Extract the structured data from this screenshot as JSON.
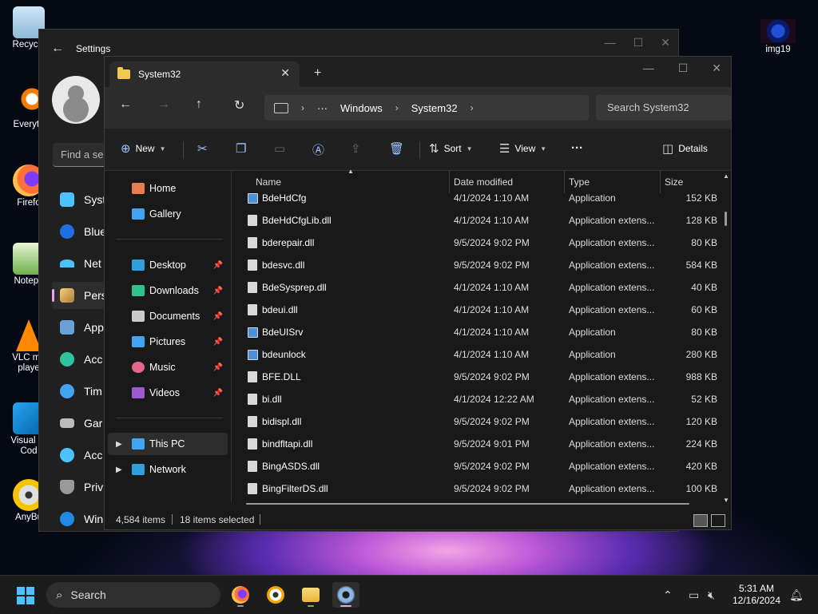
{
  "desktop": {
    "icons": [
      {
        "label": "Recycle"
      },
      {
        "label": "Everyth"
      },
      {
        "label": "Firefo"
      },
      {
        "label": "Notepa"
      },
      {
        "label": "VLC me\nplaye"
      },
      {
        "label": "Visual St\nCod"
      },
      {
        "label": "AnyBu"
      },
      {
        "label": "img19"
      }
    ]
  },
  "settings": {
    "title": "Settings",
    "find_placeholder": "Find a se",
    "nav": [
      "Syst",
      "Blue",
      "Net",
      "Pers",
      "App",
      "Acc",
      "Tim",
      "Gar",
      "Acc",
      "Priv",
      "Win"
    ]
  },
  "explorer": {
    "tab_title": "System32",
    "breadcrumb": [
      "Windows",
      "System32"
    ],
    "search_placeholder": "Search System32",
    "commands": {
      "new": "New",
      "sort": "Sort",
      "view": "View",
      "details": "Details"
    },
    "tree": {
      "home": "Home",
      "gallery": "Gallery",
      "quick": [
        "Desktop",
        "Downloads",
        "Documents",
        "Pictures",
        "Music",
        "Videos"
      ],
      "this_pc": "This PC",
      "network": "Network"
    },
    "columns": {
      "name": "Name",
      "date": "Date modified",
      "type": "Type",
      "size": "Size"
    },
    "files": [
      {
        "name": "BdeHdCfg",
        "date": "4/1/2024 1:10 AM",
        "type": "Application",
        "size": "152 KB",
        "kind": "app"
      },
      {
        "name": "BdeHdCfgLib.dll",
        "date": "4/1/2024 1:10 AM",
        "type": "Application extens...",
        "size": "128 KB",
        "kind": "dll"
      },
      {
        "name": "bderepair.dll",
        "date": "9/5/2024 9:02 PM",
        "type": "Application extens...",
        "size": "80 KB",
        "kind": "dll"
      },
      {
        "name": "bdesvc.dll",
        "date": "9/5/2024 9:02 PM",
        "type": "Application extens...",
        "size": "584 KB",
        "kind": "dll"
      },
      {
        "name": "BdeSysprep.dll",
        "date": "4/1/2024 1:10 AM",
        "type": "Application extens...",
        "size": "40 KB",
        "kind": "dll"
      },
      {
        "name": "bdeui.dll",
        "date": "4/1/2024 1:10 AM",
        "type": "Application extens...",
        "size": "60 KB",
        "kind": "dll"
      },
      {
        "name": "BdeUISrv",
        "date": "4/1/2024 1:10 AM",
        "type": "Application",
        "size": "80 KB",
        "kind": "app"
      },
      {
        "name": "bdeunlock",
        "date": "4/1/2024 1:10 AM",
        "type": "Application",
        "size": "280 KB",
        "kind": "app"
      },
      {
        "name": "BFE.DLL",
        "date": "9/5/2024 9:02 PM",
        "type": "Application extens...",
        "size": "988 KB",
        "kind": "dll"
      },
      {
        "name": "bi.dll",
        "date": "4/1/2024 12:22 AM",
        "type": "Application extens...",
        "size": "52 KB",
        "kind": "dll"
      },
      {
        "name": "bidispl.dll",
        "date": "9/5/2024 9:02 PM",
        "type": "Application extens...",
        "size": "120 KB",
        "kind": "dll"
      },
      {
        "name": "bindfltapi.dll",
        "date": "9/5/2024 9:01 PM",
        "type": "Application extens...",
        "size": "224 KB",
        "kind": "dll"
      },
      {
        "name": "BingASDS.dll",
        "date": "9/5/2024 9:02 PM",
        "type": "Application extens...",
        "size": "420 KB",
        "kind": "dll"
      },
      {
        "name": "BingFilterDS.dll",
        "date": "9/5/2024 9:02 PM",
        "type": "Application extens...",
        "size": "100 KB",
        "kind": "dll"
      }
    ],
    "status": {
      "count": "4,584 items",
      "selected": "18 items selected"
    }
  },
  "taskbar": {
    "search_label": "Search",
    "time": "5:31 AM",
    "date": "12/16/2024"
  },
  "colors": {
    "accent": "#4cc2ff",
    "highlight": "#e7a7e9",
    "folder": "#f2c94c"
  }
}
